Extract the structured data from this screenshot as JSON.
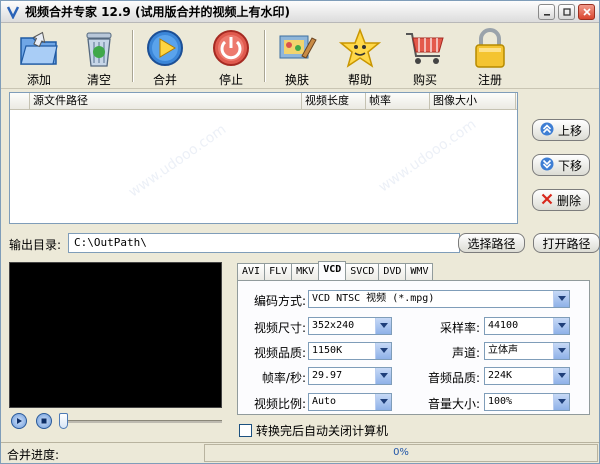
{
  "window": {
    "title": "视频合并专家 12.9 (试用版合并的视频上有水印)"
  },
  "toolbar": {
    "add": "添加",
    "clear": "清空",
    "merge": "合并",
    "stop": "停止",
    "skin": "换肤",
    "help": "帮助",
    "buy": "购买",
    "register": "注册"
  },
  "filelist": {
    "columns": [
      "源文件路径",
      "视频长度",
      "帧率",
      "图像大小"
    ]
  },
  "side": {
    "up": "上移",
    "down": "下移",
    "delete": "删除"
  },
  "output": {
    "label": "输出目录:",
    "path": "C:\\OutPath\\",
    "choose": "选择路径",
    "open": "打开路径"
  },
  "tabs": [
    "AVI",
    "FLV",
    "MKV",
    "VCD",
    "SVCD",
    "DVD",
    "WMV"
  ],
  "settings": {
    "codec_label": "编码方式:",
    "codec_value": "VCD NTSC 视频 (*.mpg)",
    "size_label": "视频尺寸:",
    "size_value": "352x240",
    "quality_label": "视频品质:",
    "quality_value": "1150K",
    "fps_label": "帧率/秒:",
    "fps_value": "29.97",
    "ratio_label": "视频比例:",
    "ratio_value": "Auto",
    "samplerate_label": "采样率:",
    "samplerate_value": "44100",
    "channel_label": "声道:",
    "channel_value": "立体声",
    "audioq_label": "音频品质:",
    "audioq_value": "224K",
    "volume_label": "音量大小:",
    "volume_value": "100%"
  },
  "shutdown": {
    "label": "转换完后自动关闭计算机",
    "checked": false
  },
  "status": {
    "label": "合并进度:",
    "progress_text": "0%",
    "progress_value": 0
  },
  "watermark": "www.udooo.com",
  "colors": {
    "accent": "#3a86d8",
    "title_bg": "#ece9d8"
  }
}
